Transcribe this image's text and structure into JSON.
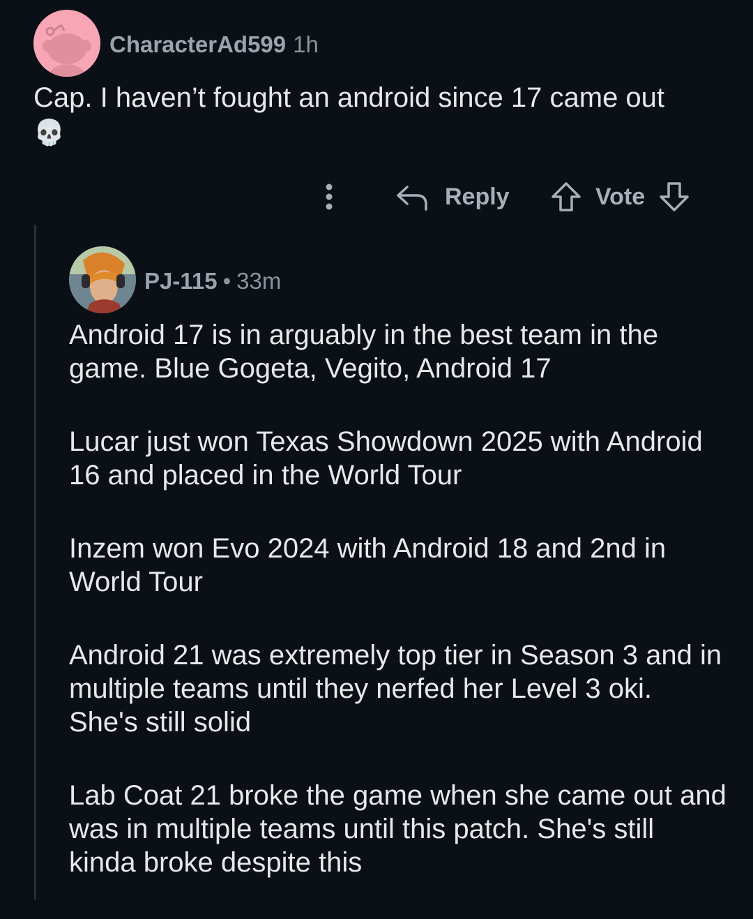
{
  "top_comment": {
    "username": "CharacterAd599",
    "time": "1h",
    "text": "Cap. I haven’t fought an android since 17 came out",
    "emoji": "💀",
    "avatar_icon": "reddit-snoo-avatar",
    "avatar_color": "#f8a6b6"
  },
  "actions": {
    "more_icon": "more-vertical-icon",
    "reply_label": "Reply",
    "vote_label": "Vote"
  },
  "reply_comment": {
    "username": "PJ-115",
    "separator": "•",
    "time": "33m",
    "avatar_icon": "user-avatar-icon",
    "paragraphs": [
      "Android 17 is in arguably in the best team in the game. Blue Gogeta, Vegito, Android 17",
      "Lucar just won Texas Showdown 2025 with Android 16 and placed in the World Tour",
      "Inzem won Evo 2024 with Android 18 and 2nd in World Tour",
      "Android 21 was extremely top tier in Season 3 and in multiple teams until they nerfed her Level 3 oki. She's still solid",
      "Lab Coat 21 broke the game when she came out and was in multiple teams until this patch. She's still kinda broke despite this"
    ]
  },
  "colors": {
    "background": "#0b1016",
    "text": "#e6e8ea",
    "muted": "#9aa4ad",
    "thread_line": "#2a3038"
  }
}
